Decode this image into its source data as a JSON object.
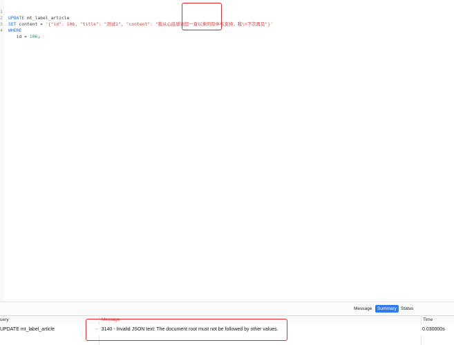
{
  "editor": {
    "lines": [
      {
        "num": "1",
        "kw": "UPDATE",
        "rest": " mt_label_article"
      },
      {
        "num": "2",
        "kw": "SET",
        "rest": " content = ",
        "str": "'{\"id\": 106, \"title\": \"测试1\", \"content\": \"我从心底感谢您一直以来的陪伴与支持，我\\n下次再见\"}'"
      },
      {
        "num": "3",
        "kw": "WHERE",
        "rest": ""
      },
      {
        "num": "4",
        "kw": "",
        "rest": "   id = ",
        "numval": "106",
        "tail": ";"
      }
    ]
  },
  "result": {
    "tabs": [
      {
        "label": "Message",
        "active": false
      },
      {
        "label": "Summary",
        "active": true
      },
      {
        "label": "Status",
        "active": false
      }
    ],
    "columns": [
      "uery",
      "Message",
      "Time"
    ],
    "row": {
      "query": "UPDATE mt_label_article",
      "dash": "--",
      "message": "3140 - Invalid JSON text: The document root must not be followed by other values.",
      "time": "0.030000s"
    }
  },
  "colors": {
    "keyword": "#1e6fd0",
    "string": "#d23c3c",
    "number": "#2a9b66",
    "annotation": "#e0262b",
    "active_tab": "#2f7bea"
  }
}
